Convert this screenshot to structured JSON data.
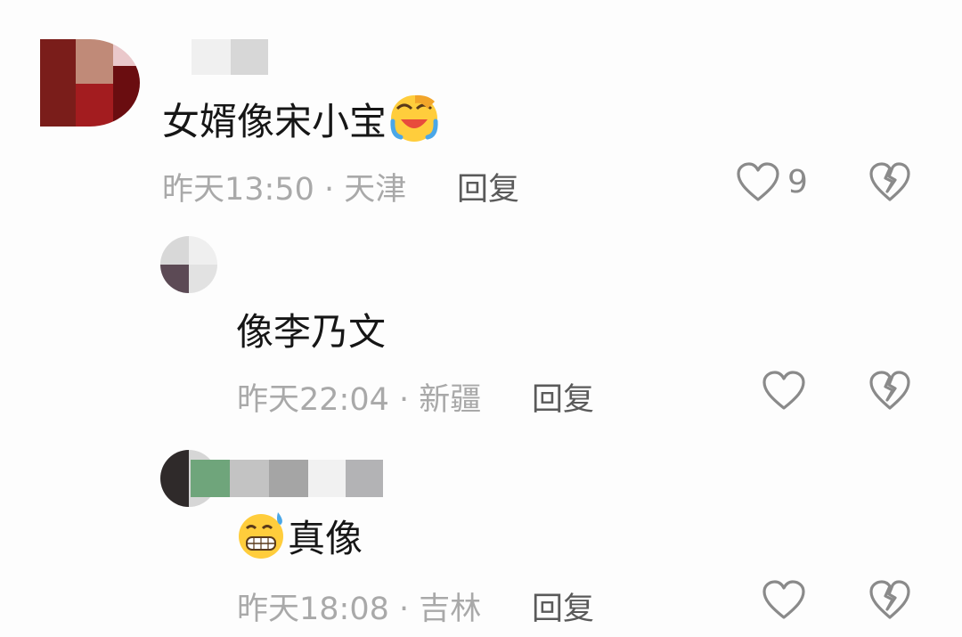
{
  "comments": [
    {
      "text": "女婿像宋小宝",
      "emoji": "rolling-laughing-emoji",
      "time": "昨天13:50",
      "location": "天津",
      "reply_label": "回复",
      "like_count": "9"
    },
    {
      "text": "像李乃文",
      "time": "昨天22:04",
      "location": "新疆",
      "reply_label": "回复"
    },
    {
      "text": "真像",
      "emoji": "grinning-sweat-emoji",
      "time": "昨天18:08",
      "location": "吉林",
      "reply_label": "回复"
    }
  ],
  "separator": "·",
  "colors": {
    "text": "#161616",
    "meta": "#a9a9a9",
    "icon": "#8a8a8a"
  }
}
